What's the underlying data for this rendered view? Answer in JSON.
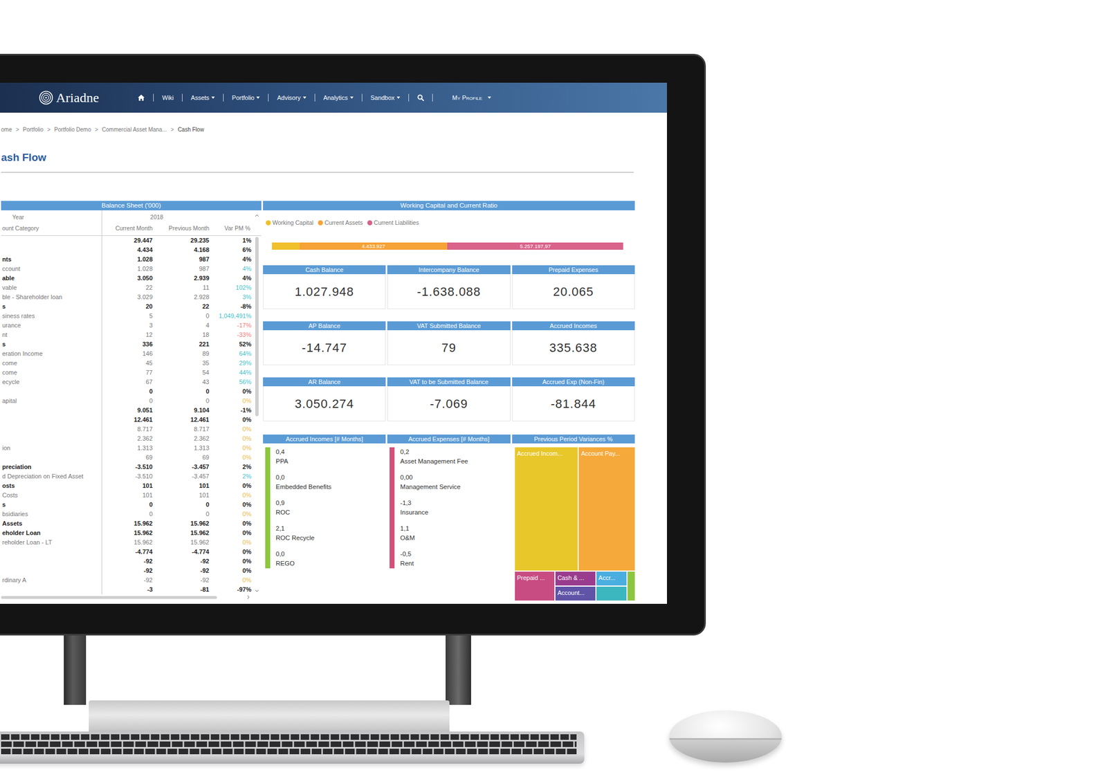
{
  "nav": {
    "logo": "Ariadne",
    "items": [
      {
        "label": "Wiki",
        "dropdown": false
      },
      {
        "label": "Assets",
        "dropdown": true
      },
      {
        "label": "Portfolio",
        "dropdown": true
      },
      {
        "label": "Advisory",
        "dropdown": true
      },
      {
        "label": "Analytics",
        "dropdown": true
      },
      {
        "label": "Sandbox",
        "dropdown": true
      }
    ],
    "profile": {
      "label": "My Profile",
      "dropdown": true
    }
  },
  "breadcrumb": {
    "separator": ">",
    "items": [
      {
        "label": "ome",
        "current": false
      },
      {
        "label": "Portfolio",
        "current": false
      },
      {
        "label": "Portfolio Demo",
        "current": false
      },
      {
        "label": "Commercial Asset Mana...",
        "current": false
      },
      {
        "label": "Cash Flow",
        "current": true
      }
    ]
  },
  "page_title": "ash Flow",
  "balance_sheet": {
    "title": "Balance Sheet ('000)",
    "year_label": "Year",
    "year": "2018",
    "category_label": "ount Category",
    "columns": [
      "Current Month",
      "Previous Month",
      "Var PM %"
    ],
    "scroll": {
      "vertical": 0.5,
      "horizontal": 0.83
    },
    "rows": [
      {
        "kind": "total",
        "current": "29.447",
        "previous": "29.235",
        "variance": "1%",
        "color": "#222222"
      },
      {
        "kind": "total",
        "current": "4.434",
        "previous": "4.168",
        "variance": "6%",
        "color": "#222222"
      },
      {
        "kind": "total",
        "label": "nts",
        "current": "1.028",
        "previous": "987",
        "variance": "4%",
        "color": "#222222"
      },
      {
        "kind": "detail",
        "label": "ccount",
        "current": "1.028",
        "previous": "987",
        "variance": "4%",
        "color": "#45c1c9"
      },
      {
        "kind": "total",
        "label": "able",
        "current": "3.050",
        "previous": "2.939",
        "variance": "4%",
        "color": "#222222"
      },
      {
        "kind": "detail",
        "label": "vable",
        "current": "22",
        "previous": "11",
        "variance": "102%",
        "color": "#45c1c9"
      },
      {
        "kind": "detail",
        "label": "ble - Shareholder loan",
        "current": "3.029",
        "previous": "2.928",
        "variance": "3%",
        "color": "#45c1c9"
      },
      {
        "kind": "total",
        "label": "s",
        "current": "20",
        "previous": "22",
        "variance": "-8%",
        "color": "#222222"
      },
      {
        "kind": "detail",
        "label": "siness rates",
        "current": "5",
        "previous": "0",
        "variance": "1,049,491%",
        "color": "#45c1c9"
      },
      {
        "kind": "detail",
        "label": "urance",
        "current": "3",
        "previous": "4",
        "variance": "-17%",
        "color": "#f07a7a"
      },
      {
        "kind": "detail",
        "label": "nt",
        "current": "12",
        "previous": "18",
        "variance": "-33%",
        "color": "#f07a7a"
      },
      {
        "kind": "total",
        "label": "s",
        "current": "336",
        "previous": "221",
        "variance": "52%",
        "color": "#222222"
      },
      {
        "kind": "detail",
        "label": "eration Income",
        "current": "146",
        "previous": "89",
        "variance": "64%",
        "color": "#45c1c9"
      },
      {
        "kind": "detail",
        "label": "come",
        "current": "45",
        "previous": "35",
        "variance": "29%",
        "color": "#45c1c9"
      },
      {
        "kind": "detail",
        "label": "come",
        "current": "77",
        "previous": "54",
        "variance": "44%",
        "color": "#45c1c9"
      },
      {
        "kind": "detail",
        "label": "ecycle",
        "current": "67",
        "previous": "43",
        "variance": "56%",
        "color": "#45c1c9"
      },
      {
        "kind": "total",
        "current": "0",
        "previous": "0",
        "variance": "0%",
        "color": "#222222"
      },
      {
        "kind": "detail",
        "label": "apital",
        "current": "0",
        "previous": "0",
        "variance": "0%",
        "color": "#e8b84a"
      },
      {
        "kind": "total",
        "current": "9.051",
        "previous": "9.104",
        "variance": "-1%",
        "color": "#222222"
      },
      {
        "kind": "total",
        "current": "12.461",
        "previous": "12.461",
        "variance": "0%",
        "color": "#222222"
      },
      {
        "kind": "detail",
        "current": "8.717",
        "previous": "8.717",
        "variance": "0%",
        "color": "#e8b84a"
      },
      {
        "kind": "detail",
        "current": "2.362",
        "previous": "2.362",
        "variance": "0%",
        "color": "#e8b84a"
      },
      {
        "kind": "detail",
        "label": "ion",
        "current": "1.313",
        "previous": "1.313",
        "variance": "0%",
        "color": "#e8b84a"
      },
      {
        "kind": "detail",
        "current": "69",
        "previous": "69",
        "variance": "0%",
        "color": "#e8b84a"
      },
      {
        "kind": "total",
        "label": "preciation",
        "current": "-3.510",
        "previous": "-3.457",
        "variance": "2%",
        "color": "#222222"
      },
      {
        "kind": "detail",
        "label": "d Depreciation on Fixed Asset",
        "current": "-3.510",
        "previous": "-3.457",
        "variance": "2%",
        "color": "#45c1c9"
      },
      {
        "kind": "total",
        "label": "osts",
        "current": "101",
        "previous": "101",
        "variance": "0%",
        "color": "#222222"
      },
      {
        "kind": "detail",
        "label": "Costs",
        "current": "101",
        "previous": "101",
        "variance": "0%",
        "color": "#e8b84a"
      },
      {
        "kind": "total",
        "label": "s",
        "current": "0",
        "previous": "0",
        "variance": "0%",
        "color": "#222222"
      },
      {
        "kind": "detail",
        "label": "bsidiaries",
        "current": "0",
        "previous": "0",
        "variance": "0%",
        "color": "#e8b84a"
      },
      {
        "kind": "total",
        "label": "Assets",
        "current": "15.962",
        "previous": "15.962",
        "variance": "0%",
        "color": "#222222"
      },
      {
        "kind": "total",
        "label": "eholder Loan",
        "current": "15.962",
        "previous": "15.962",
        "variance": "0%",
        "color": "#222222"
      },
      {
        "kind": "detail",
        "label": "reholder Loan - LT",
        "current": "15.962",
        "previous": "15.962",
        "variance": "0%",
        "color": "#e8b84a"
      },
      {
        "kind": "total",
        "current": "-4.774",
        "previous": "-4.774",
        "variance": "0%",
        "color": "#222222"
      },
      {
        "kind": "total",
        "current": "-92",
        "previous": "-92",
        "variance": "0%",
        "color": "#222222"
      },
      {
        "kind": "total",
        "current": "-92",
        "previous": "-92",
        "variance": "0%",
        "color": "#222222"
      },
      {
        "kind": "detail",
        "label": "rdinary A",
        "current": "-92",
        "previous": "-92",
        "variance": "0%",
        "color": "#e8b84a"
      },
      {
        "kind": "total",
        "current": "-3",
        "previous": "-81",
        "variance": "-97%",
        "color": "#222222"
      }
    ]
  },
  "working_capital": {
    "title": "Working Capital and Current Ratio",
    "series": [
      {
        "name": "Working Capital",
        "color": "#f0c02c",
        "values": [
          823270
        ]
      },
      {
        "name": "Current Assets",
        "color": "#f5a336",
        "values": [
          4433927
        ],
        "label": "4.433.927"
      },
      {
        "name": "Current Liabilities",
        "color": "#d9628a",
        "values": [
          5257197.97
        ],
        "label": "5.257.197,97"
      }
    ]
  },
  "kpis": [
    {
      "title": "Cash Balance",
      "value": "1.027.948"
    },
    {
      "title": "Intercompany Balance",
      "value": "-1.638.088"
    },
    {
      "title": "Prepaid Expenses",
      "value": "20.065"
    },
    {
      "title": "AP Balance",
      "value": "-14.747"
    },
    {
      "title": "VAT Submitted Balance",
      "value": "79"
    },
    {
      "title": "Accrued Incomes",
      "value": "335.638"
    },
    {
      "title": "AR Balance",
      "value": "3.050.274"
    },
    {
      "title": "VAT to be Submitted Balance",
      "value": "-7.069"
    },
    {
      "title": "Accrued Exp (Non-Fin)",
      "value": "-81.844"
    }
  ],
  "accrued_incomes": {
    "title": "Accrued Incomes [# Months]",
    "color": "#8dc63f",
    "items": [
      {
        "value": "0,4",
        "label": "PPA"
      },
      {
        "value": "0,0",
        "label": "Embedded Benefits"
      },
      {
        "value": "0,9",
        "label": "ROC"
      },
      {
        "value": "2,1",
        "label": "ROC Recycle"
      },
      {
        "value": "0,0",
        "label": "REGO"
      }
    ]
  },
  "accrued_expenses": {
    "title": "Accrued Expenses [# Months]",
    "color": "#d4507a",
    "items": [
      {
        "value": "0,2",
        "label": "Asset Management Fee"
      },
      {
        "value": "0,00",
        "label": "Management Service"
      },
      {
        "value": "-1,3",
        "label": "Insurance"
      },
      {
        "value": "1,1",
        "label": "O&M"
      },
      {
        "value": "-0,5",
        "label": "Rent"
      }
    ]
  },
  "variances": {
    "title": "Previous Period Variances %",
    "tiles": [
      {
        "label": "Accrued Incom...",
        "color": "#e8c72b",
        "value": 25308
      },
      {
        "label": "Account Pay...",
        "color": "#f5a93a",
        "value": 22422
      },
      {
        "label": "Prepaid ...",
        "color": "#c84c82",
        "value": 3744
      },
      {
        "label": "Cash & ...",
        "color": "#9a3c8e",
        "value": 1898
      },
      {
        "label": "Account...",
        "color": "#5f54a8",
        "value": 1898
      },
      {
        "label": "Accr...",
        "color": "#4aaee0",
        "value": 1430
      },
      {
        "color": "#3cb6bf",
        "value": 1430
      },
      {
        "color": "#8cc63f",
        "value": 676
      }
    ]
  }
}
